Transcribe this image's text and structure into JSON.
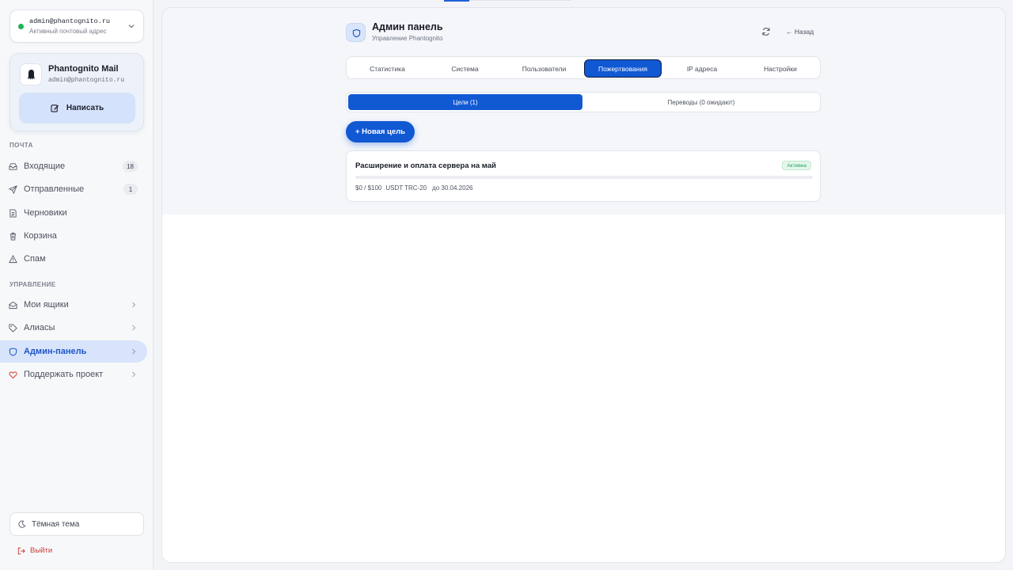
{
  "account": {
    "email": "admin@phantognito.ru",
    "status": "Активный почтовый адрес"
  },
  "profile": {
    "name": "Phantognito Mail",
    "email": "admin@phantognito.ru",
    "compose_label": "Написать"
  },
  "sidebar": {
    "mail_section": "ПОЧТА",
    "mail_items": [
      {
        "label": "Входящие",
        "count": "18",
        "icon": "inbox-icon"
      },
      {
        "label": "Отправленные",
        "count": "1",
        "icon": "send-icon"
      },
      {
        "label": "Черновики",
        "icon": "draft-icon"
      },
      {
        "label": "Корзина",
        "icon": "trash-icon"
      },
      {
        "label": "Спам",
        "icon": "warning-icon"
      }
    ],
    "manage_section": "УПРАВЛЕНИЕ",
    "manage_items": [
      {
        "label": "Мои ящики",
        "icon": "mailbox-icon"
      },
      {
        "label": "Алиасы",
        "icon": "tag-icon"
      },
      {
        "label": "Админ-панель",
        "icon": "shield-icon",
        "active": true
      },
      {
        "label": "Поддержать проект",
        "icon": "heart-icon"
      }
    ],
    "theme_label": "Тёмная тема",
    "logout_label": "Выйти"
  },
  "header": {
    "title": "Админ панель",
    "subtitle": "Управление Phantognito",
    "back_label": "← Назад"
  },
  "tabs": [
    {
      "label": "Статистика"
    },
    {
      "label": "Система"
    },
    {
      "label": "Пользователи"
    },
    {
      "label": "Пожертвования",
      "active": true
    },
    {
      "label": "IP адреса"
    },
    {
      "label": "Настройки"
    }
  ],
  "subtabs": [
    {
      "label": "Цели (1)",
      "active": true
    },
    {
      "label": "Переводы (0 ожидают)"
    }
  ],
  "new_goal_label": "+ Новая цель",
  "goal": {
    "title": "Расширение и оплата сервера на май",
    "status": "Активна",
    "progress": 0,
    "amount": "$0 / $100",
    "currency": "USDT TRC-20",
    "deadline": "до 30.04.2026"
  },
  "colors": {
    "accent": "#1158d3",
    "active_nav_bg": "#d7e4fb",
    "success": "#20a660",
    "danger": "#d03a32"
  }
}
